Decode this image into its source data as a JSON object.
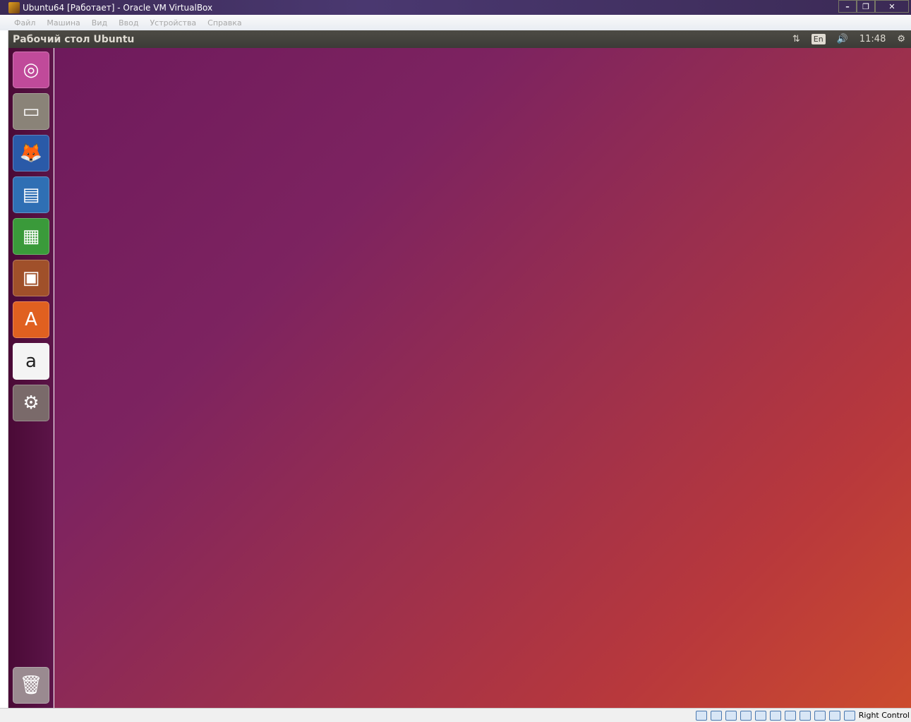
{
  "window": {
    "title": "Ubuntu64 [Работает] - Oracle VM VirtualBox",
    "minimize": "–",
    "restore": "❐",
    "close": "✕"
  },
  "menu": [
    "Файл",
    "Машина",
    "Вид",
    "Ввод",
    "Устройства",
    "Справка"
  ],
  "panel": {
    "title": "Рабочий стол Ubuntu",
    "network": "⇅",
    "keyboard": "En",
    "volume": "🔊",
    "clock": "11:48",
    "power": "⚙"
  },
  "launcher": [
    {
      "name": "ubuntu-dash",
      "glyph": "◎",
      "color": "#c04a9a"
    },
    {
      "name": "files",
      "glyph": "▭",
      "color": "#8a8378"
    },
    {
      "name": "firefox",
      "glyph": "🦊",
      "color": "#2a5aa8"
    },
    {
      "name": "libreoffice-writer",
      "glyph": "▤",
      "color": "#2f6fb4"
    },
    {
      "name": "libreoffice-calc",
      "glyph": "▦",
      "color": "#3a9a3a"
    },
    {
      "name": "libreoffice-impress",
      "glyph": "▣",
      "color": "#a0502a"
    },
    {
      "name": "software-center",
      "glyph": "A",
      "color": "#e06020"
    },
    {
      "name": "amazon",
      "glyph": "a",
      "color": "#f4f4f4"
    },
    {
      "name": "system-settings",
      "glyph": "⚙",
      "color": "#7a6a6a"
    }
  ],
  "trash": {
    "glyph": "🗑",
    "color": "#9a8a90"
  },
  "status": {
    "host_key": "Right Control"
  }
}
